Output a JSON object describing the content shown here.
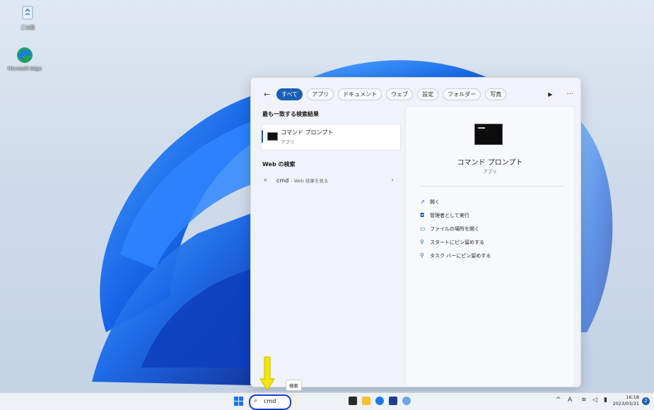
{
  "desktop": {
    "icons": [
      {
        "label": "ごみ箱",
        "icon": "recycle-bin-icon"
      },
      {
        "label": "Microsoft Edge",
        "icon": "edge-icon"
      }
    ]
  },
  "search_panel": {
    "filters": [
      "すべて",
      "アプリ",
      "ドキュメント",
      "ウェブ",
      "設定",
      "フォルダー",
      "写真"
    ],
    "active_filter": "すべて",
    "best_match_heading": "最も一致する検索結果",
    "best_match": {
      "title": "コマンド プロンプト",
      "subtitle": "アプリ"
    },
    "web_heading": "Web の検索",
    "web_result": {
      "query": "cmd",
      "suffix": "- Web 結果を見る"
    },
    "detail": {
      "title": "コマンド プロンプト",
      "subtitle": "アプリ",
      "actions": [
        {
          "label": "開く",
          "icon": "open-icon"
        },
        {
          "label": "管理者として実行",
          "icon": "shield-icon"
        },
        {
          "label": "ファイルの場所を開く",
          "icon": "folder-icon"
        },
        {
          "label": "スタートにピン留めする",
          "icon": "pin-icon"
        },
        {
          "label": "タスク バーにピン留めする",
          "icon": "pin-icon"
        }
      ]
    }
  },
  "taskbar": {
    "search_value": "cmd",
    "tooltip": "検索",
    "clock_time": "16:18",
    "clock_date": "2023/03/31",
    "notification_count": "2",
    "ime": "A"
  },
  "colors": {
    "accent": "#1a5fb4",
    "arrow": "#f5e50a",
    "highlight_border": "#1a3fd6"
  }
}
